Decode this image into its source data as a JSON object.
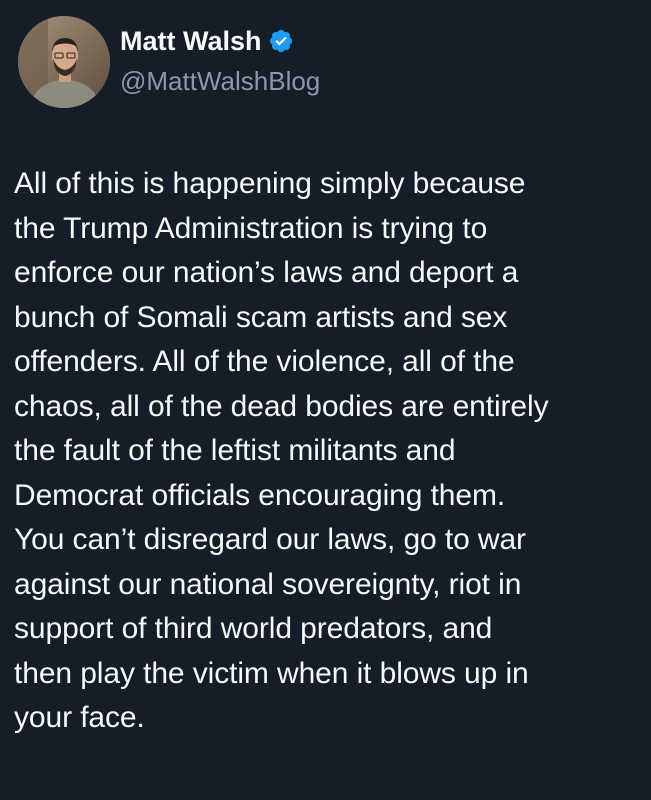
{
  "tweet": {
    "author": {
      "display_name": "Matt Walsh",
      "handle": "@MattWalshBlog",
      "verified": true,
      "verified_color": "#1d9bf0"
    },
    "text_lines": [
      "All of this is happening simply because",
      "the Trump Administration is trying to",
      "enforce our nation’s laws and deport a",
      "bunch of Somali scam artists and sex",
      "offenders. All of the violence, all of the",
      "chaos, all of the dead bodies are entirely",
      "the fault of the leftist militants and",
      "Democrat officials encouraging them.",
      "You can’t disregard our laws, go to war",
      "against our national sovereignty, riot in",
      "support of third world predators, and",
      "then play the victim when it blows up in",
      "your face."
    ]
  },
  "colors": {
    "background": "#151d28",
    "text": "#f5f7f9",
    "handle": "#8b98a5"
  }
}
